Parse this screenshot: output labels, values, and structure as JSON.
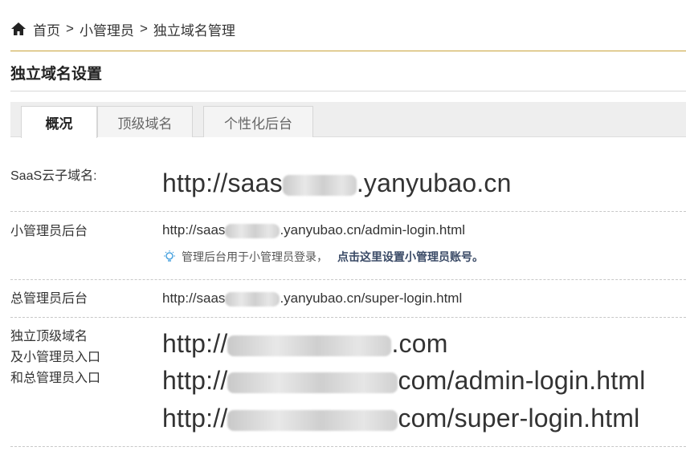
{
  "breadcrumb": {
    "home": "首页",
    "sep1": ">",
    "item1": "小管理员",
    "sep2": ">",
    "item2": "独立域名管理"
  },
  "section_title": "独立域名设置",
  "tabs": [
    {
      "label": "概况",
      "active": true
    },
    {
      "label": "顶级域名",
      "active": false
    },
    {
      "label": "个性化后台",
      "active": false
    }
  ],
  "rows": {
    "saas": {
      "label": "SaaS云子域名:",
      "url_prefix": "http://saas",
      "url_suffix": ".yanyubao.cn"
    },
    "admin": {
      "label": "小管理员后台",
      "url_prefix": "http://saas",
      "url_suffix": ".yanyubao.cn/admin-login.html",
      "tip_text": "管理后台用于小管理员登录，",
      "tip_link": "点击这里设置小管理员账号。"
    },
    "super": {
      "label": "总管理员后台",
      "url_prefix": "http://saas",
      "url_suffix": ".yanyubao.cn/super-login.html"
    },
    "independent": {
      "label_line1": "独立顶级域名",
      "label_line2": "及小管理员入口",
      "label_line3": "和总管理员入口",
      "url1_prefix": "http://",
      "url1_suffix": ".com",
      "url2_prefix": "http://",
      "url2_suffix": "com/admin-login.html",
      "url3_prefix": "http://",
      "url3_suffix": "com/super-login.html"
    }
  },
  "colors": {
    "gold_rule": "#c9a23a",
    "tip_link": "#3a4a66",
    "bulb": "#4aa3df"
  },
  "icons": {
    "home": "home-icon",
    "tip": "lightbulb-icon"
  }
}
